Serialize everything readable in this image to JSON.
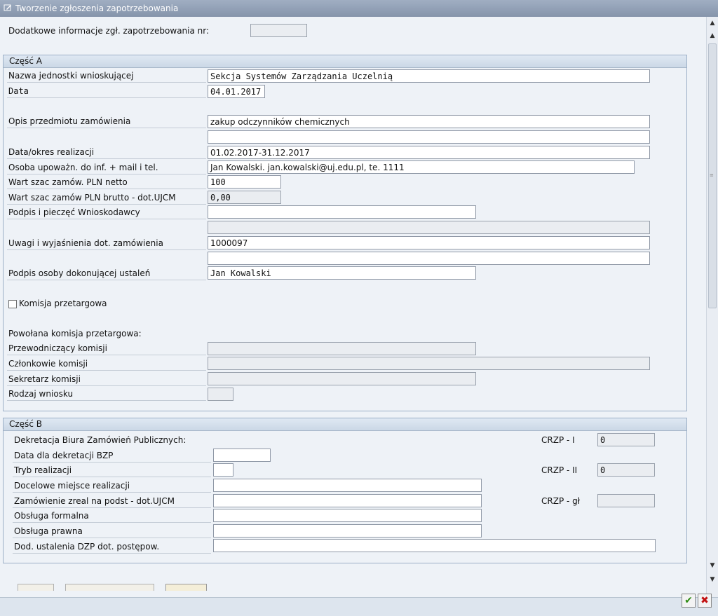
{
  "window": {
    "title": "Tworzenie zgłoszenia zapotrzebowania"
  },
  "top": {
    "label": "Dodatkowe informacje zgł. zapotrzebowania nr:",
    "value": ""
  },
  "part_a": {
    "title": "Część A",
    "unit_name_label": "Nazwa jednostki wnioskującej",
    "unit_name_value": "Sekcja Systemów Zarządzania Uczelnią",
    "date_label": "Data",
    "date_value": "04.01.2017",
    "subject_label": "Opis przedmiotu zamówienia",
    "subject_value": "zakup odczynników chemicznych",
    "subject_value2": "",
    "period_label": "Data/okres realizacji",
    "period_value": "01.02.2017-31.12.2017",
    "contact_label": "Osoba upoważn. do inf. + mail i tel.",
    "contact_value": "Jan Kowalski. jan.kowalski@uj.edu.pl, te. 1111",
    "net_label": "Wart szac zamów. PLN netto",
    "net_value": "100",
    "gross_label": "Wart szac zamów PLN brutto - dot.UJCM",
    "gross_value": "0,00",
    "signature_label": "Podpis i pieczęć Wnioskodawcy",
    "signature_value": "",
    "signature_value2": "",
    "remarks_label": "Uwagi i wyjaśnienia dot. zamówienia",
    "remarks_value": "1000097",
    "remarks_value2": "",
    "approver_label": "Podpis osoby dokonującej ustaleń",
    "approver_value": "Jan Kowalski",
    "commission_checkbox_label": "Komisja przetargowa",
    "commission_heading": "Powołana komisja przetargowa:",
    "chair_label": "Przewodniczący komisji",
    "members_label": "Członkowie komisji",
    "secretary_label": "Sekretarz komisji",
    "request_type_label": "Rodzaj wniosku"
  },
  "part_b": {
    "title": "Część B",
    "decree_label": "Dekretacja Biura Zamówień Publicznych:",
    "decree_date_label": "Data dla dekretacji BZP",
    "mode_label": "Tryb realizacji",
    "target_label": "Docelowe miejsce realizacji",
    "order_label": "Zamówienie zreal na podst - dot.UJCM",
    "formal_label": "Obsługa formalna",
    "legal_label": "Obsługa prawna",
    "dzp_label": "Dod. ustalenia DZP dot. postępow.",
    "crzp1_label": "CRZP - I",
    "crzp1_value": "0",
    "crzp2_label": "CRZP - II",
    "crzp2_value": "0",
    "crzpg_label": "CRZP - gł",
    "crzpg_value": ""
  },
  "colors": {
    "title_bar": "#8f9db3",
    "background": "#eef2f7",
    "ok": "#2d8a12",
    "cancel": "#c21010"
  },
  "icons": {
    "title": "edit-form-icon",
    "ok": "checkmark-icon",
    "cancel": "cross-icon"
  }
}
